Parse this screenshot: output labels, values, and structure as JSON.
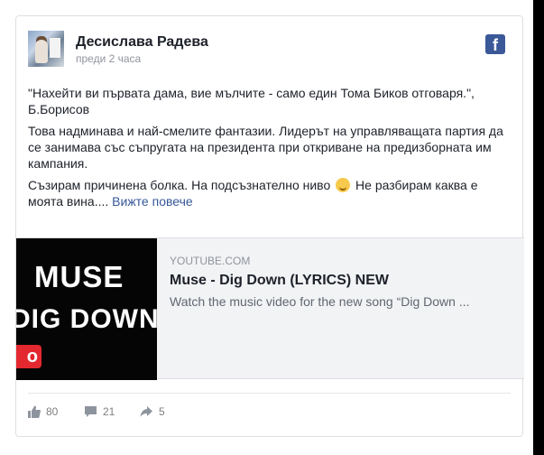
{
  "post": {
    "author": "Десислава Радева",
    "time": "преди 2 часа",
    "paragraphs": [
      "\"Нахейти ви първата дама, вие мълчите - само един Тома Биков отговаря.\", Б.Борисов",
      "Това надминава и най-смелите фантазии. Лидерът на управляващата партия да се занимава със съпругата на президента при откриване на предизборната им кампания."
    ],
    "last_paragraph_before_emoji": "Съзирам причинена болка. На подсъзнателно ниво ",
    "last_paragraph_after_emoji": " Не разбирам каква е моята вина....",
    "see_more": "Вижте повече",
    "emoji_icon": "smile-emoji-icon"
  },
  "attachment": {
    "domain": "YOUTUBE.COM",
    "title": "Muse - Dig Down (LYRICS) NEW",
    "description": "Watch the music video for the new song “Dig Down ...",
    "thumb_line1": "MUSE",
    "thumb_line2": "DIG DOWN",
    "thumb_badge": "o"
  },
  "stats": {
    "likes": "80",
    "comments": "21",
    "shares": "5"
  },
  "brand": {
    "fb_letter": "f",
    "fb_color": "#3b5998"
  }
}
